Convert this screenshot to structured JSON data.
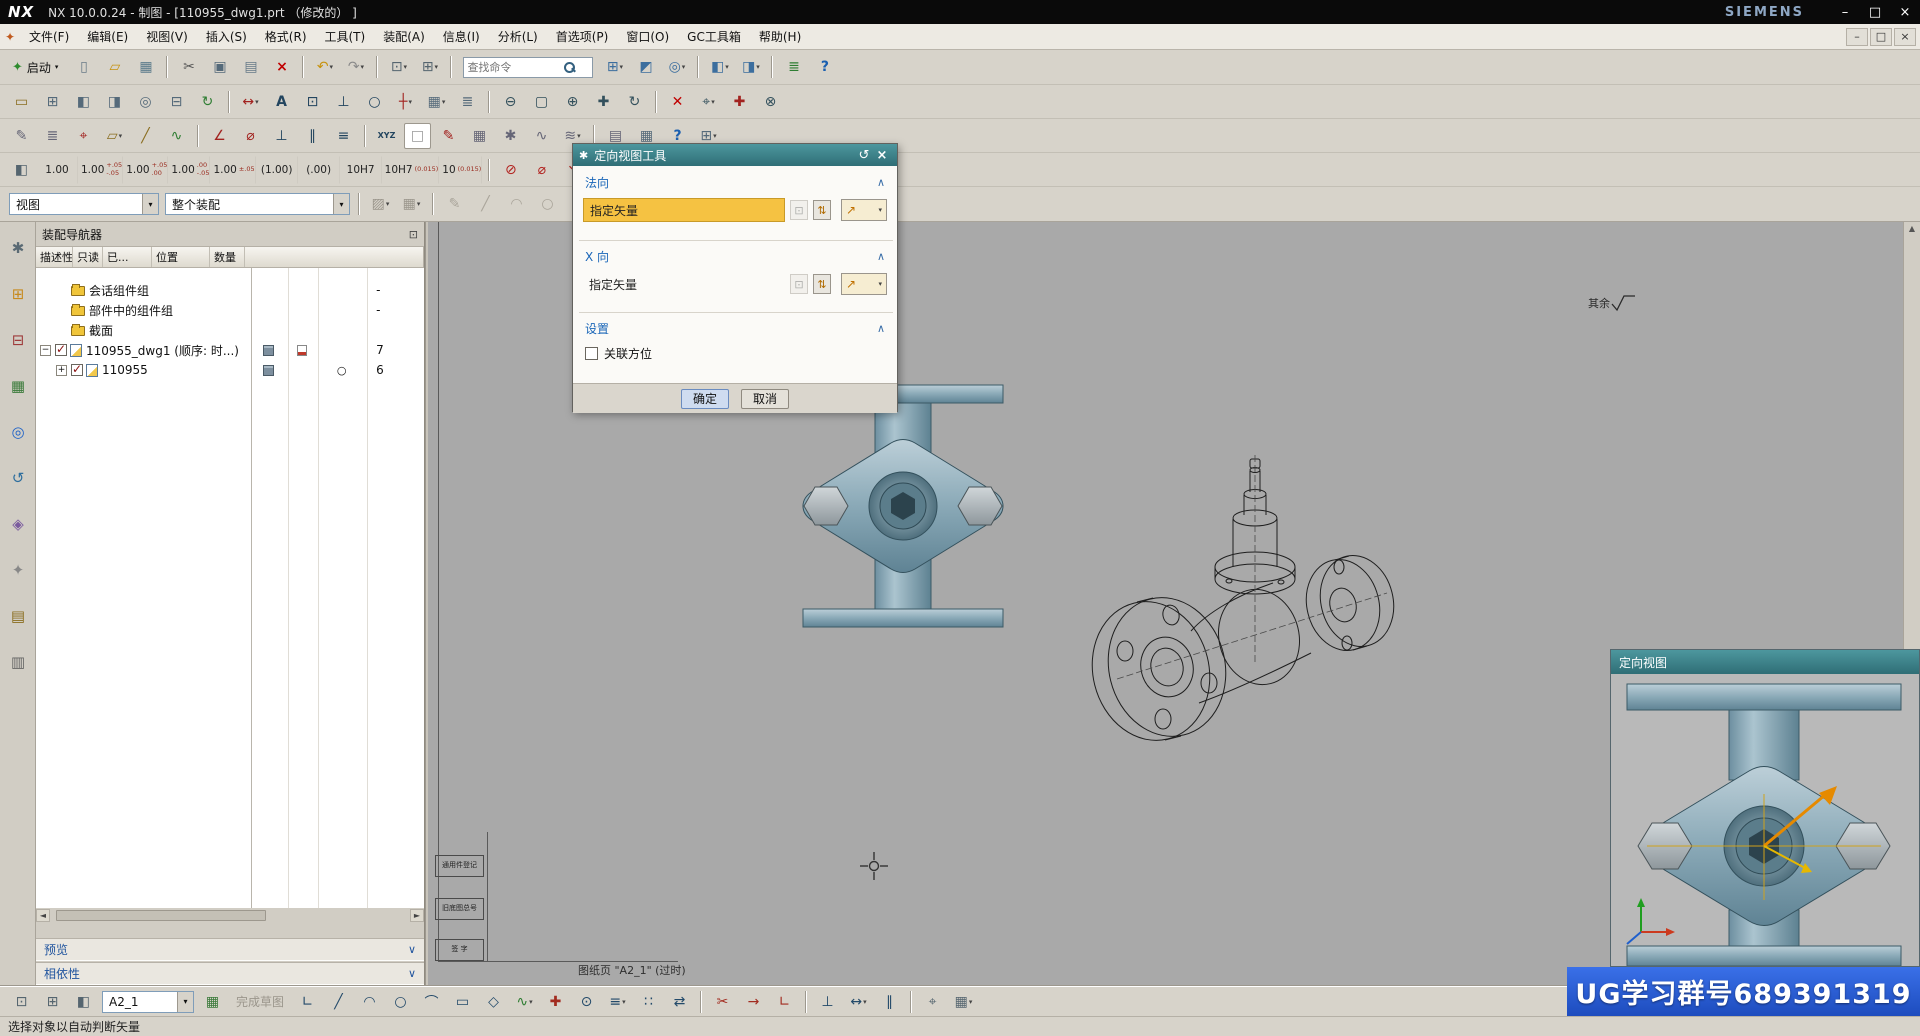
{
  "window": {
    "logo": "NX",
    "title": "NX 10.0.0.24 - 制图 - [110955_dwg1.prt （修改的） ]",
    "brand": "SIEMENS",
    "controls": {
      "minimize": "–",
      "maximize": "□",
      "close": "×"
    }
  },
  "menubar": {
    "items": [
      {
        "n": "menu-file",
        "label": "文件(F)"
      },
      {
        "n": "menu-edit",
        "label": "编辑(E)"
      },
      {
        "n": "menu-view",
        "label": "视图(V)"
      },
      {
        "n": "menu-insert",
        "label": "插入(S)"
      },
      {
        "n": "menu-format",
        "label": "格式(R)"
      },
      {
        "n": "menu-tools",
        "label": "工具(T)"
      },
      {
        "n": "menu-assemblies",
        "label": "装配(A)"
      },
      {
        "n": "menu-information",
        "label": "信息(I)"
      },
      {
        "n": "menu-analysis",
        "label": "分析(L)"
      },
      {
        "n": "menu-preferences",
        "label": "首选项(P)"
      },
      {
        "n": "menu-window",
        "label": "窗口(O)"
      },
      {
        "n": "menu-gc-toolbox",
        "label": "GC工具箱"
      },
      {
        "n": "menu-help",
        "label": "帮助(H)"
      }
    ],
    "controls": {
      "minimize": "–",
      "restore": "□",
      "close": "×"
    }
  },
  "toolbars": {
    "start_label": "启动",
    "start_caret": "▾",
    "search_placeholder": "查找命令",
    "row1a": [
      {
        "n": "new-file-button",
        "g": "▯",
        "css": "color:#6a7b88"
      },
      {
        "n": "open-button",
        "g": "▱",
        "css": "color:#c7920e"
      },
      {
        "n": "save-button",
        "g": "▦",
        "css": "color:#5a7a8a"
      },
      {
        "n": "separator",
        "sep": "1",
        "ia": "false"
      },
      {
        "n": "cut-button",
        "g": "✂",
        "css": "color:#555"
      },
      {
        "n": "copy-button",
        "g": "▣",
        "css": "color:#556a7a"
      },
      {
        "n": "paste-button",
        "g": "▤",
        "css": "color:#667a88"
      },
      {
        "n": "delete-button",
        "g": "×",
        "css": "color:#c00000;font-weight:700"
      },
      {
        "n": "separator",
        "sep": "1",
        "ia": "false"
      },
      {
        "n": "undo-button",
        "g": "↶",
        "css": "color:#c7920e",
        "dd": "▾"
      },
      {
        "n": "redo-button",
        "g": "↷",
        "css": "color:#8a8a8a",
        "dd": "▾"
      },
      {
        "n": "separator",
        "sep": "1",
        "ia": "false"
      },
      {
        "n": "repeat-command-button",
        "g": "⊡",
        "css": "color:#55656f",
        "dd": "▾"
      },
      {
        "n": "window-layout-button",
        "g": "⊞",
        "css": "color:#55656f",
        "dd": "▾"
      },
      {
        "n": "separator",
        "sep": "1",
        "ia": "false"
      }
    ],
    "row1b": [
      {
        "n": "view-group-button",
        "g": "⊞",
        "css": "color:#3c6e9e",
        "dd": "▾"
      },
      {
        "n": "display-part-button",
        "g": "◩",
        "css": "color:#3c6e9e"
      },
      {
        "n": "show-hide-button",
        "g": "◎",
        "css": "color:#3c6e9e",
        "dd": "▾"
      },
      {
        "n": "separator",
        "sep": "1",
        "ia": "false"
      },
      {
        "n": "orient-view-button",
        "g": "◧",
        "css": "color:#3c6e9e",
        "dd": "▾"
      },
      {
        "n": "render-style-button",
        "g": "◨",
        "css": "color:#3c6e9e",
        "dd": "▾"
      },
      {
        "n": "separator",
        "sep": "1",
        "ia": "false"
      },
      {
        "n": "info-button",
        "g": "≣",
        "css": "color:#2e7d32"
      },
      {
        "n": "help-button",
        "g": "?",
        "css": "color:#1a5fb0;font-weight:700"
      }
    ],
    "row2": [
      {
        "n": "new-sheet-button",
        "g": "▭",
        "css": "color:#8a6d1f"
      },
      {
        "n": "view-wizard-button",
        "g": "⊞",
        "css": "color:#556a7a"
      },
      {
        "n": "base-view-button",
        "g": "◧",
        "css": "color:#556a7a"
      },
      {
        "n": "projected-view-button",
        "g": "◨",
        "css": "color:#556a7a"
      },
      {
        "n": "detail-view-button",
        "g": "◎",
        "css": "color:#556a7a"
      },
      {
        "n": "section-view-button",
        "g": "⊟",
        "css": "color:#556a7a"
      },
      {
        "n": "update-views-button",
        "g": "↻",
        "css": "color:#2e7d32"
      },
      {
        "n": "separator",
        "sep": "1",
        "ia": "false"
      },
      {
        "n": "rapid-dimension-button",
        "g": "↔",
        "css": "color:#a2221f",
        "dd": "▾"
      },
      {
        "n": "note-button",
        "g": "A",
        "css": "color:#23455f;font-weight:700"
      },
      {
        "n": "feature-control-frame-button",
        "g": "⊡",
        "css": "color:#23455f"
      },
      {
        "n": "datum-feature-button",
        "g": "⊥",
        "css": "color:#23455f"
      },
      {
        "n": "balloon-button",
        "g": "○",
        "css": "color:#23455f"
      },
      {
        "n": "centerline-button",
        "g": "┼",
        "css": "color:#a2221f",
        "dd": "▾"
      },
      {
        "n": "table-button",
        "g": "▦",
        "css": "color:#556a7a",
        "dd": "▾"
      },
      {
        "n": "parts-list-button",
        "g": "≣",
        "css": "color:#556a7a"
      },
      {
        "n": "separator",
        "sep": "1",
        "ia": "false"
      },
      {
        "n": "zoom-out-button",
        "g": "⊖",
        "css": "color:#33505c"
      },
      {
        "n": "zoom-fit-button",
        "g": "▢",
        "css": "color:#33505c"
      },
      {
        "n": "zoom-in-button",
        "g": "⊕",
        "css": "color:#33505c"
      },
      {
        "n": "pan-button",
        "g": "✚",
        "css": "color:#33505c"
      },
      {
        "n": "rotate-view-button",
        "g": "↻",
        "css": "color:#33505c"
      },
      {
        "n": "separator",
        "sep": "1",
        "ia": "false"
      },
      {
        "n": "close-view-button",
        "g": "✕",
        "css": "color:#c00000"
      },
      {
        "n": "snap-point-button",
        "g": "⌖",
        "css": "color:#33505c",
        "dd": "▾"
      },
      {
        "n": "point-tool-button",
        "g": "✚",
        "css": "color:#a2221f"
      },
      {
        "n": "intersection-button",
        "g": "⊗",
        "css": "color:#33505c"
      }
    ],
    "row3": [
      {
        "n": "preferences-button",
        "g": "✎",
        "css": "color:#667"
      },
      {
        "n": "layer-settings-button",
        "g": "≣",
        "css": "color:#667"
      },
      {
        "n": "wcs-button",
        "g": "⌖",
        "css": "color:#a2221f"
      },
      {
        "n": "datum-plane-button",
        "g": "▱",
        "css": "color:#8a6d1f",
        "dd": "▾"
      },
      {
        "n": "datum-axis-button",
        "g": "╱",
        "css": "color:#8a6d1f"
      },
      {
        "n": "sketch-tool-button",
        "g": "∿",
        "css": "color:#2e7d32"
      },
      {
        "n": "separator",
        "sep": "1",
        "ia": "false"
      },
      {
        "n": "angle-dimension-button",
        "g": "∠",
        "css": "color:#a2221f"
      },
      {
        "n": "diameter-dimension-button",
        "g": "⌀",
        "css": "color:#a2221f"
      },
      {
        "n": "perpendicular-constraint-button",
        "g": "⊥",
        "css": "color:#23455f"
      },
      {
        "n": "parallel-constraint-button",
        "g": "∥",
        "css": "color:#23455f"
      },
      {
        "n": "symmetry-constraint-button",
        "g": "≡",
        "css": "color:#23455f"
      },
      {
        "n": "separator",
        "sep": "1",
        "ia": "false"
      },
      {
        "n": "xyz-point-button",
        "g": "XYZ",
        "css": "color:#23455f;font-size:8px;font-weight:700"
      },
      {
        "n": "blank-swatch-button",
        "g": "□",
        "css": "color:#999;background:#fff;border:1px solid #9d988e"
      },
      {
        "n": "annotation-edit-button",
        "g": "✎",
        "css": "color:#a2221f"
      },
      {
        "n": "grid-display-button",
        "g": "▦",
        "css": "color:#667"
      },
      {
        "n": "customize-button",
        "g": "✱",
        "css": "color:#667"
      },
      {
        "n": "spline-button",
        "g": "∿",
        "css": "color:#667"
      },
      {
        "n": "wave-link-button",
        "g": "≋",
        "css": "color:#667",
        "dd": "▾"
      },
      {
        "n": "separator",
        "sep": "1",
        "ia": "false"
      },
      {
        "n": "image-button",
        "g": "▤",
        "css": "color:#667"
      },
      {
        "n": "tabular-note-button",
        "g": "▦",
        "css": "color:#556a7a"
      },
      {
        "n": "context-help-button",
        "g": "?",
        "css": "color:#1a5fb0;font-weight:700"
      },
      {
        "n": "view-list-button",
        "g": "⊞",
        "css": "color:#556a7a",
        "dd": "▾"
      }
    ],
    "row4_lead": [
      {
        "n": "dimension-style-button",
        "g": "◧",
        "css": "color:#55656f"
      }
    ],
    "presets": [
      {
        "n": "tol-preset-basic",
        "t": "1.00"
      },
      {
        "n": "tol-preset-upper-lower",
        "t": "1.00",
        "s": "+.05",
        "b": "-.05"
      },
      {
        "n": "tol-preset-upper",
        "t": "1.00",
        "s": "+.05",
        "b": ".00"
      },
      {
        "n": "tol-preset-lower",
        "t": "1.00",
        "s": ".00",
        "b": "-.05"
      },
      {
        "n": "tol-preset-symmetric",
        "t": "1.00",
        "s": "±.05"
      },
      {
        "n": "tol-preset-reference",
        "t": "(1.00)"
      },
      {
        "n": "tol-preset-reference-zero",
        "t": "(.00)"
      },
      {
        "n": "tol-preset-fit",
        "t": "10H7"
      },
      {
        "n": "tol-preset-fit-tolerance",
        "t": "10H7",
        "s": "(0.015)"
      },
      {
        "n": "tol-preset-fit-value",
        "t": "10",
        "s": "(0.015)"
      }
    ],
    "row4_icons": [
      {
        "n": "separator",
        "sep": "1",
        "ia": "false"
      },
      {
        "n": "no-diameter-symbol-button",
        "g": "⊘",
        "css": "color:#b2221f"
      },
      {
        "n": "diameter-symbol-button",
        "g": "⌀",
        "css": "color:#b2221f"
      },
      {
        "n": "leader-button",
        "g": "↘",
        "css": "color:#b2221f"
      },
      {
        "n": "edit-dimension-button",
        "g": "✎",
        "css": "color:#b2221f"
      },
      {
        "n": "separator",
        "sep": "1",
        "ia": "false"
      },
      {
        "n": "radial-dimension-button",
        "g": "⊕",
        "css": "color:#b2221f"
      },
      {
        "n": "angular-dimension-button",
        "g": "∠",
        "css": "color:#b2221f"
      }
    ],
    "row5": {
      "view_value": "视图",
      "assembly_value": "整个装配",
      "caret": "▾",
      "icons": [
        {
          "n": "separator",
          "sep": "1",
          "ia": "false"
        },
        {
          "n": "brush-button",
          "g": "▨",
          "css": "color:#9b968c",
          "dd": "▾"
        },
        {
          "n": "palette-button",
          "g": "▦",
          "css": "color:#9b968c",
          "dd": "▾"
        },
        {
          "n": "separator",
          "sep": "1",
          "ia": "false"
        },
        {
          "n": "edit-curve-button",
          "g": "✎",
          "css": "color:#aaa59b"
        },
        {
          "n": "line-tool-button",
          "g": "╱",
          "css": "color:#aaa59b"
        },
        {
          "n": "arc-tool-button",
          "g": "◠",
          "css": "color:#aaa59b"
        },
        {
          "n": "circle-tool-button",
          "g": "○",
          "css": "color:#aaa59b"
        }
      ]
    }
  },
  "resource_bar": {
    "icons": [
      {
        "n": "resource-options-icon",
        "g": "✱",
        "css": "color:#5a6a74"
      },
      {
        "n": "assembly-navigator-icon",
        "g": "⊞",
        "css": "color:#c78a1e"
      },
      {
        "n": "constraint-navigator-icon",
        "g": "⊟",
        "css": "color:#9e3a3a"
      },
      {
        "n": "part-navigator-icon",
        "g": "▦",
        "css": "color:#3a7a3a"
      },
      {
        "n": "internet-explorer-icon",
        "g": "◎",
        "css": "color:#1e62c8"
      },
      {
        "n": "history-icon",
        "g": "↺",
        "css": "color:#2e6e9e"
      },
      {
        "n": "process-studio-icon",
        "g": "◈",
        "css": "color:#7a5a9e"
      },
      {
        "n": "manufacturing-wizard-icon",
        "g": "✦",
        "css": "color:#888"
      },
      {
        "n": "reuse-library-icon",
        "g": "▤",
        "css": "color:#8a6d1f"
      },
      {
        "n": "system-materials-icon",
        "g": "▥",
        "css": "color:#666"
      }
    ]
  },
  "navigator": {
    "title": "装配导航器",
    "float_glyph": "⊡",
    "columns": [
      {
        "label": "描述性部件名",
        "sort": "▲"
      },
      {
        "label": "只读"
      },
      {
        "label": "已..."
      },
      {
        "label": "位置"
      },
      {
        "label": "数量"
      }
    ],
    "rows": [
      {
        "lvl": "1",
        "ico": "ico ico-folder",
        "name": "会话组件组",
        "qty": "-"
      },
      {
        "lvl": "1",
        "ico": "ico ico-folder",
        "name": "部件中的组件组",
        "qty": "-"
      },
      {
        "lvl": "1",
        "ico": "ico ico-folder",
        "name": "截面"
      },
      {
        "lvl": "0",
        "exp": "−",
        "chk": "1",
        "ico": "ico ico-part",
        "name": "110955_dwg1 (顺序: 时...)",
        "ro": "mini mini-disk",
        "ex": "mini mini-mod",
        "qty": "7"
      },
      {
        "lvl": "1",
        "exp": "+",
        "chk": "1",
        "ico": "ico ico-part",
        "name": "110955",
        "ro": "mini mini-disk",
        "pos": "○",
        "qty": "6"
      }
    ],
    "hscroll": {
      "left": "◄",
      "right": "►"
    },
    "sections": [
      {
        "n": "preview-section-header",
        "label": "预览",
        "chev": "∨"
      },
      {
        "n": "dependencies-section-header",
        "label": "相依性",
        "chev": "∨"
      }
    ]
  },
  "dialog": {
    "title": "定向视图工具",
    "icon_glyph": "✱",
    "reset_glyph": "↺",
    "close_glyph": "×",
    "vector_dialog_glyph": "⊡",
    "reverse_glyph": "⇅",
    "vector_glyph": "↗",
    "caret": "▾",
    "normal": {
      "title": "法向",
      "collapse": "∧",
      "field_label": "指定矢量"
    },
    "xdir": {
      "title": "X 向",
      "collapse": "∧",
      "field_label": "指定矢量"
    },
    "settings": {
      "title": "设置",
      "collapse": "∧",
      "checkbox_label": "关联方位"
    },
    "buttons": {
      "ok": "确定",
      "cancel": "取消"
    },
    "highlight_color": "#f5c242",
    "header_color": "#3d8a91"
  },
  "canvas": {
    "sheet_note": "图纸页 \"A2_1\" (过时)",
    "roughness_note": "其余",
    "titleblock_cells": [
      {
        "label": "通用件登记"
      },
      {
        "label": "旧底图总号"
      },
      {
        "label": "签 字"
      }
    ]
  },
  "preview": {
    "title": "定向视图"
  },
  "banner": {
    "text": "UG学习群号689391319",
    "color": "#2a5fd4"
  },
  "bottom_bar": {
    "left_icons": [
      {
        "n": "task-environment-button",
        "g": "⊡",
        "css": "color:#55656f"
      },
      {
        "n": "sheet-zones-button",
        "g": "⊞",
        "css": "color:#55656f"
      },
      {
        "n": "sheet-margins-button",
        "g": "◧",
        "css": "color:#55656f"
      }
    ],
    "sheet_combo_value": "A2_1",
    "caret": "▾",
    "grid_icon": {
      "g": "▦"
    },
    "finish_label": "完成草图",
    "icons": [
      {
        "n": "profile-button",
        "g": "∟",
        "css": "color:#234a6a"
      },
      {
        "n": "line-button",
        "g": "╱",
        "css": "color:#234a6a"
      },
      {
        "n": "arc-button",
        "g": "◠",
        "css": "color:#234a6a"
      },
      {
        "n": "circle-button",
        "g": "○",
        "css": "color:#234a6a"
      },
      {
        "n": "fillet-button",
        "g": "⌒",
        "css": "color:#234a6a"
      },
      {
        "n": "rectangle-button",
        "g": "▭",
        "css": "color:#234a6a"
      },
      {
        "n": "polygon-button",
        "g": "◇",
        "css": "color:#234a6a"
      },
      {
        "n": "studio-spline-button",
        "g": "∿",
        "css": "color:#2e7d32",
        "dd": "▾"
      },
      {
        "n": "point-button",
        "g": "✚",
        "css": "color:#a22b1f"
      },
      {
        "n": "ellipse-button",
        "g": "⊙",
        "css": "color:#234a6a"
      },
      {
        "n": "offset-curve-button",
        "g": "≡",
        "css": "color:#234a6a",
        "dd": "▾"
      },
      {
        "n": "pattern-curve-button",
        "g": "∷",
        "css": "color:#234a6a"
      },
      {
        "n": "mirror-curve-button",
        "g": "⇄",
        "css": "color:#234a6a"
      },
      {
        "n": "separator",
        "sep": "1",
        "ia": "false"
      },
      {
        "n": "trim-button",
        "g": "✂",
        "css": "color:#a22b1f"
      },
      {
        "n": "extend-button",
        "g": "→",
        "css": "color:#a22b1f"
      },
      {
        "n": "corner-button",
        "g": "∟",
        "css": "color:#a22b1f"
      },
      {
        "n": "separator",
        "sep": "1",
        "ia": "false"
      },
      {
        "n": "geometric-constraints-button",
        "g": "⊥",
        "css": "color:#234a6a"
      },
      {
        "n": "rapid-dimension-sketch-button",
        "g": "↔",
        "css": "color:#234a6a",
        "dd": "▾"
      },
      {
        "n": "make-symmetric-button",
        "g": "∥",
        "css": "color:#234a6a"
      },
      {
        "n": "separator",
        "sep": "1",
        "ia": "false"
      },
      {
        "n": "snap-settings-button",
        "g": "⌖",
        "css": "color:#55656f"
      },
      {
        "n": "grid-settings-button",
        "g": "▦",
        "css": "color:#55656f",
        "dd": "▾"
      }
    ]
  },
  "status_bar": {
    "message": "选择对象以自动判断矢量"
  }
}
